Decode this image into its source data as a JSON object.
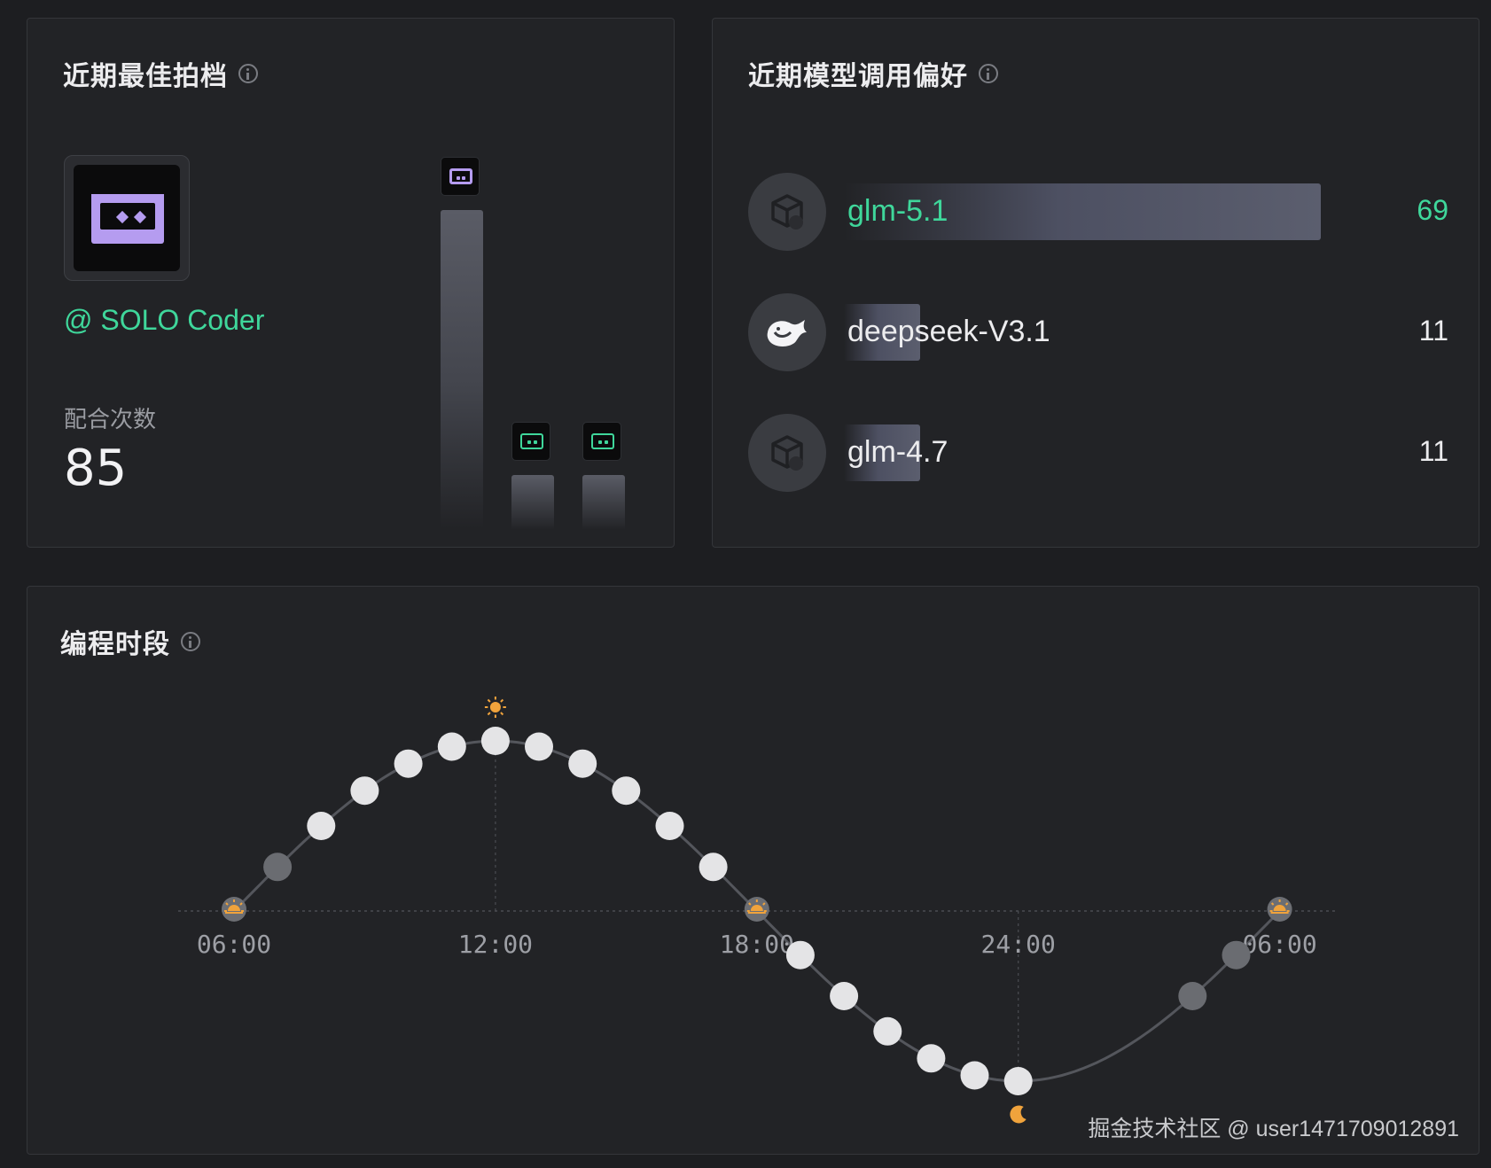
{
  "partner": {
    "title": "近期最佳拍档",
    "name": "@ SOLO Coder",
    "count_label": "配合次数",
    "count_value": "85",
    "partner_share": [
      1.0,
      0.12,
      0.12
    ]
  },
  "models": {
    "title": "近期模型调用偏好",
    "items": [
      {
        "name": "glm-5.1",
        "count": "69",
        "value": 69,
        "icon": "cube-icon",
        "color": "#3fd79b"
      },
      {
        "name": "deepseek-V3.1",
        "count": "11",
        "value": 11,
        "icon": "whale-icon",
        "color": "#ececee"
      },
      {
        "name": "glm-4.7",
        "count": "11",
        "value": 11,
        "icon": "cube-icon",
        "color": "#ececee"
      }
    ]
  },
  "schedule": {
    "title": "编程时段",
    "tick_labels": [
      "06:00",
      "12:00",
      "18:00",
      "24:00",
      "06:00"
    ],
    "hour_dots": [
      {
        "hour": 7,
        "level": "low"
      },
      {
        "hour": 8,
        "level": "high"
      },
      {
        "hour": 9,
        "level": "high"
      },
      {
        "hour": 10,
        "level": "high"
      },
      {
        "hour": 11,
        "level": "high"
      },
      {
        "hour": 12,
        "level": "high"
      },
      {
        "hour": 13,
        "level": "high"
      },
      {
        "hour": 14,
        "level": "high"
      },
      {
        "hour": 15,
        "level": "high"
      },
      {
        "hour": 16,
        "level": "high"
      },
      {
        "hour": 17,
        "level": "high"
      },
      {
        "hour": 19,
        "level": "high"
      },
      {
        "hour": 20,
        "level": "high"
      },
      {
        "hour": 21,
        "level": "high"
      },
      {
        "hour": 22,
        "level": "high"
      },
      {
        "hour": 23,
        "level": "high"
      },
      {
        "hour": 24,
        "level": "high"
      },
      {
        "hour": 28,
        "level": "low"
      },
      {
        "hour": 29,
        "level": "low"
      }
    ],
    "sunrise_icon": "sunrise-icon",
    "noon_icon": "sun-icon",
    "midnight_icon": "moon-icon",
    "accent": "#f0a33c"
  },
  "watermark": "掘金技术社区 @ user1471709012891"
}
